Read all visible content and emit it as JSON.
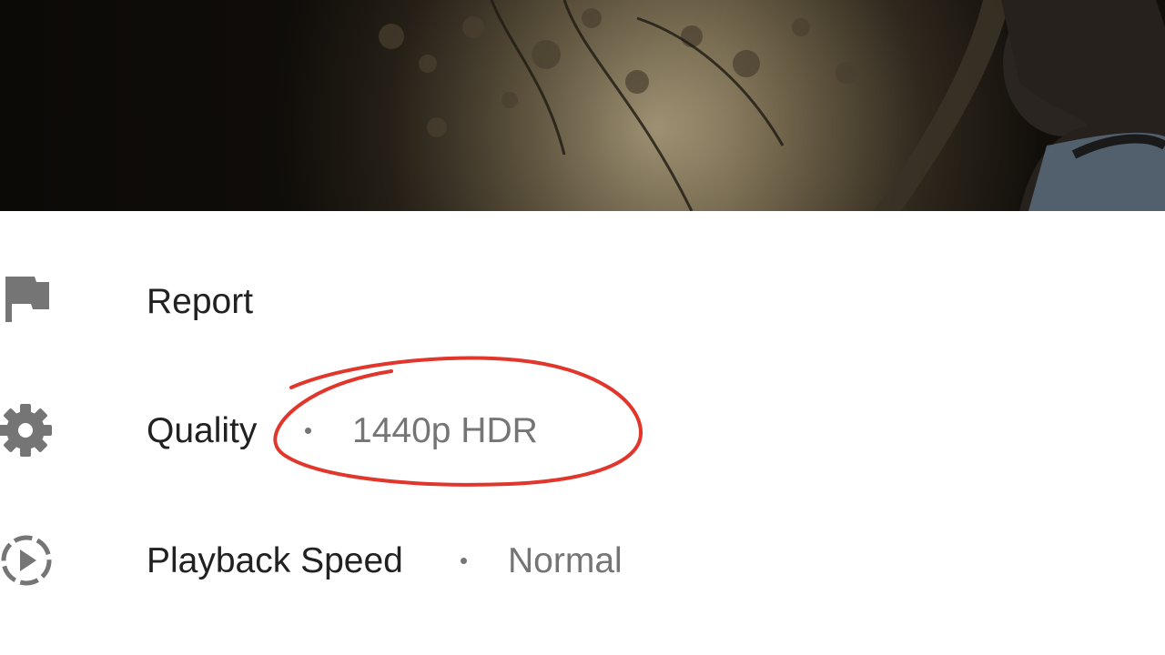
{
  "video": {
    "thumbnail_icon": "video-frame"
  },
  "menu": {
    "items": [
      {
        "label": "Report",
        "value": "",
        "icon": "flag-icon"
      },
      {
        "label": "Quality",
        "value": "1440p HDR",
        "icon": "gear-icon"
      },
      {
        "label": "Playback Speed",
        "value": "Normal",
        "icon": "playback-speed-icon"
      }
    ]
  },
  "colors": {
    "label": "#212121",
    "value": "#757575",
    "icon": "#757575",
    "annotation": "#e0362c"
  }
}
